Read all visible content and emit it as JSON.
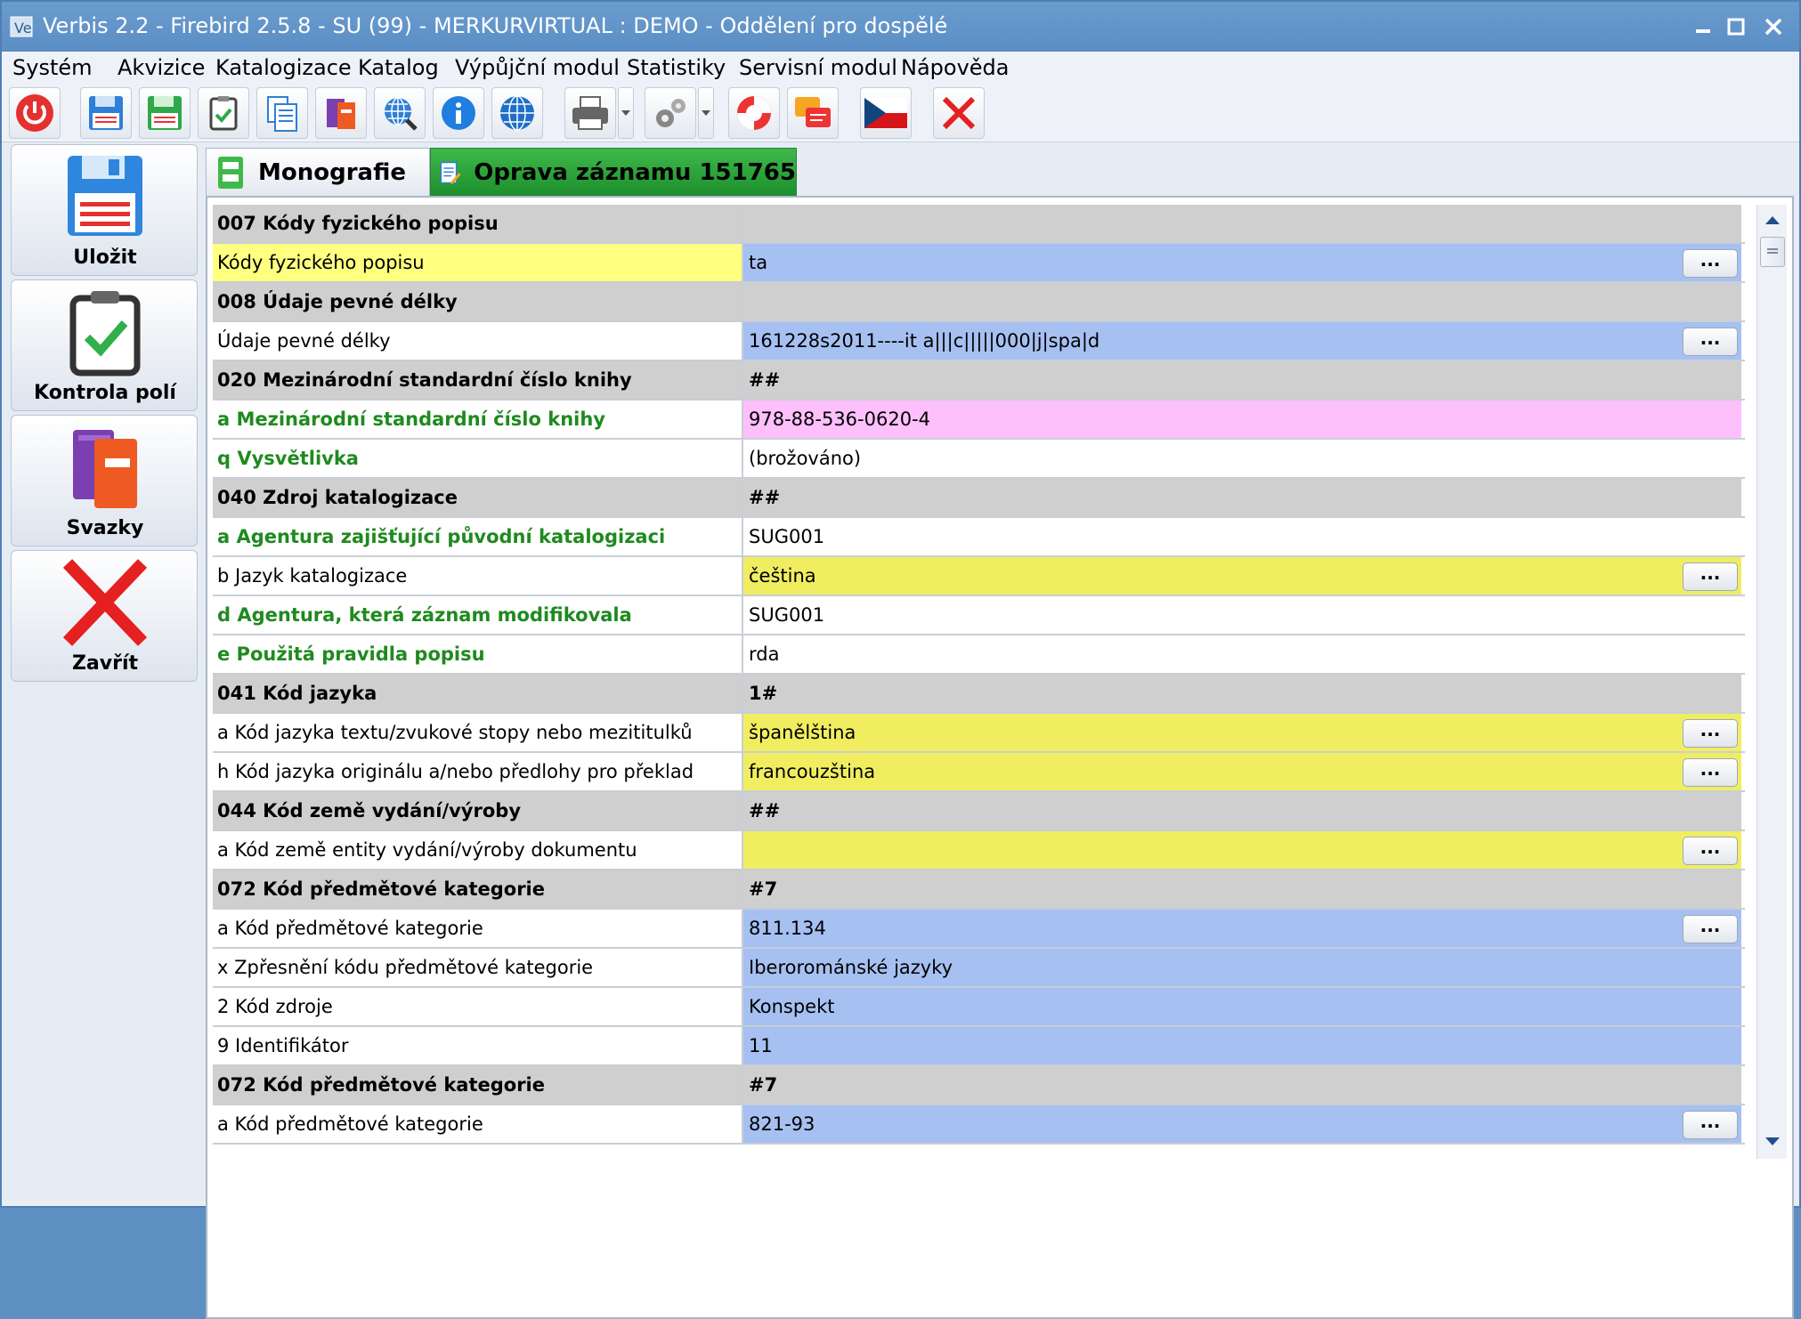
{
  "window": {
    "title": "Verbis 2.2 - Firebird 2.5.8 - SU (99) - MERKURVIRTUAL : DEMO - Oddělení pro dospělé"
  },
  "menu": {
    "items": [
      "Systém",
      "Akvizice",
      "Katalogizace",
      "Katalog",
      "Výpůjční modul",
      "Statistiky",
      "Servisní modul",
      "Nápověda"
    ]
  },
  "toolbar": {
    "icons": [
      "power-icon",
      "save-blue-icon",
      "save-green-icon",
      "clipboard-check-icon",
      "documents-icon",
      "books-icon",
      "globe-search-icon",
      "info-icon",
      "globe-icon",
      "printer-icon",
      "gears-icon",
      "lifebuoy-icon",
      "chat-icon",
      "czech-flag-icon",
      "close-red-icon"
    ]
  },
  "leftpanel": {
    "save_label": "Uložit",
    "check_label": "Kontrola polí",
    "volumes_label": "Svazky",
    "close_label": "Zavřít"
  },
  "tabs": {
    "monografie": "Monografie",
    "oprava": "Oprava záznamu 151765"
  },
  "grid": {
    "dots": "...",
    "rows": [
      {
        "label": "007 Kódy fyzického popisu",
        "value": "",
        "kind": "header"
      },
      {
        "label": "Kódy fyzického popisu",
        "value": "ta",
        "kind": "field",
        "label_style": "yellow",
        "value_style": "blue",
        "button": true
      },
      {
        "label": "008 Údaje pevné délky",
        "value": "",
        "kind": "header"
      },
      {
        "label": "Údaje pevné délky",
        "value": "161228s2011----it a|||c|||||000|j|spa|d",
        "kind": "field",
        "value_style": "blue",
        "button": true
      },
      {
        "label": "020 Mezinárodní standardní číslo knihy",
        "value": "##",
        "kind": "header"
      },
      {
        "label": "a Mezinárodní standardní číslo knihy",
        "value": "978-88-536-0620-4",
        "kind": "field",
        "label_style": "green",
        "value_style": "pink"
      },
      {
        "label": "q Vysvětlivka",
        "value": "(brožováno)",
        "kind": "field",
        "label_style": "green",
        "value_style": "white"
      },
      {
        "label": "040 Zdroj katalogizace",
        "value": "##",
        "kind": "header"
      },
      {
        "label": "a Agentura zajišťující původní katalogizaci",
        "value": "SUG001",
        "kind": "field",
        "label_style": "green",
        "value_style": "white"
      },
      {
        "label": "b Jazyk katalogizace",
        "value": "čeština",
        "kind": "field",
        "value_style": "yellow",
        "button": true
      },
      {
        "label": "d Agentura, která záznam modifikovala",
        "value": "SUG001",
        "kind": "field",
        "label_style": "green",
        "value_style": "white"
      },
      {
        "label": "e Použitá pravidla popisu",
        "value": "rda",
        "kind": "field",
        "label_style": "green",
        "value_style": "white"
      },
      {
        "label": "041 Kód jazyka",
        "value": "1#",
        "kind": "header"
      },
      {
        "label": "a Kód jazyka textu/zvukové stopy nebo mezititulků",
        "value": "španělština",
        "kind": "field",
        "value_style": "yellow",
        "button": true
      },
      {
        "label": "h Kód jazyka originálu a/nebo předlohy pro překlad",
        "value": "francouzština",
        "kind": "field",
        "value_style": "yellow",
        "button": true
      },
      {
        "label": "044 Kód země vydání/výroby",
        "value": "##",
        "kind": "header"
      },
      {
        "label": "a Kód země entity vydání/výroby dokumentu",
        "value": "",
        "kind": "field",
        "value_style": "yellow",
        "button": true
      },
      {
        "label": "072 Kód předmětové kategorie",
        "value": "#7",
        "kind": "header"
      },
      {
        "label": "a Kód předmětové kategorie",
        "value": "811.134",
        "kind": "field",
        "value_style": "blue",
        "button": true
      },
      {
        "label": "x Zpřesnění kódu předmětové kategorie",
        "value": "Iberorománské jazyky",
        "kind": "field",
        "value_style": "blue"
      },
      {
        "label": "2 Kód zdroje",
        "value": "Konspekt",
        "kind": "field",
        "value_style": "blue"
      },
      {
        "label": "9 Identifikátor",
        "value": "11",
        "kind": "field",
        "value_style": "blue"
      },
      {
        "label": "072 Kód předmětové kategorie",
        "value": "#7",
        "kind": "header"
      },
      {
        "label": "a Kód předmětové kategorie",
        "value": "821-93",
        "kind": "field",
        "value_style": "blue",
        "button": true
      }
    ]
  }
}
